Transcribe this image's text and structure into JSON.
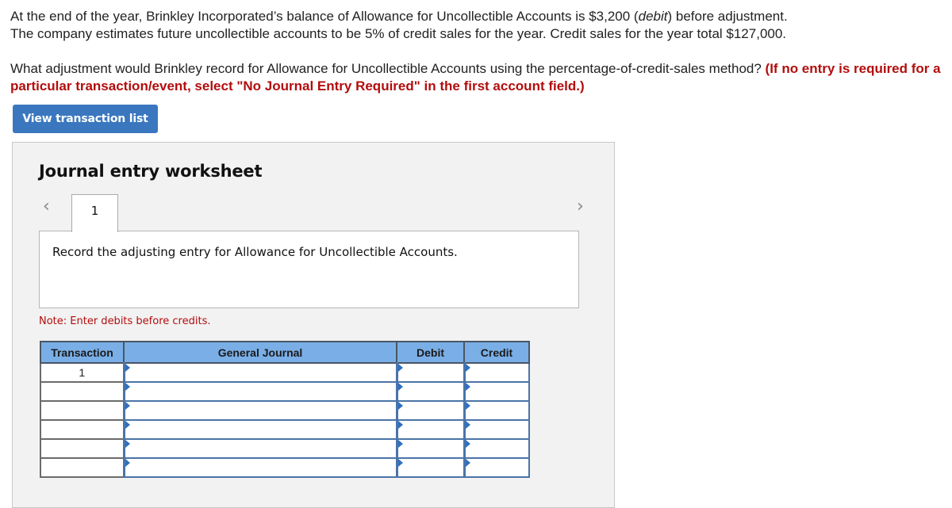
{
  "question": {
    "line1_pre": "At the end of the year, Brinkley Incorporated’s balance of Allowance for Uncollectible Accounts is $3,200 (",
    "line1_italic": "debit",
    "line1_post": ") before adjustment.",
    "line2": "The company estimates future uncollectible accounts to be 5% of credit sales for the year. Credit sales for the year total $127,000.",
    "prompt": "What adjustment would Brinkley record for Allowance for Uncollectible Accounts using the percentage-of-credit-sales method? ",
    "instruction": "(If no entry is required for a particular transaction/event, select \"No Journal Entry Required\" in the first account field.)"
  },
  "buttons": {
    "view_transactions": "View transaction list"
  },
  "worksheet": {
    "title": "Journal entry worksheet",
    "prev_icon": "‹",
    "next_icon": "›",
    "tabs": [
      {
        "label": "1"
      }
    ],
    "description": "Record the adjusting entry for Allowance for Uncollectible Accounts.",
    "note": "Note: Enter debits before credits."
  },
  "table": {
    "headers": [
      "Transaction",
      "General Journal",
      "Debit",
      "Credit"
    ],
    "rows": [
      {
        "transaction": "1",
        "account": "",
        "debit": "",
        "credit": ""
      },
      {
        "transaction": "",
        "account": "",
        "debit": "",
        "credit": ""
      },
      {
        "transaction": "",
        "account": "",
        "debit": "",
        "credit": ""
      },
      {
        "transaction": "",
        "account": "",
        "debit": "",
        "credit": ""
      },
      {
        "transaction": "",
        "account": "",
        "debit": "",
        "credit": ""
      },
      {
        "transaction": "",
        "account": "",
        "debit": "",
        "credit": ""
      }
    ]
  }
}
